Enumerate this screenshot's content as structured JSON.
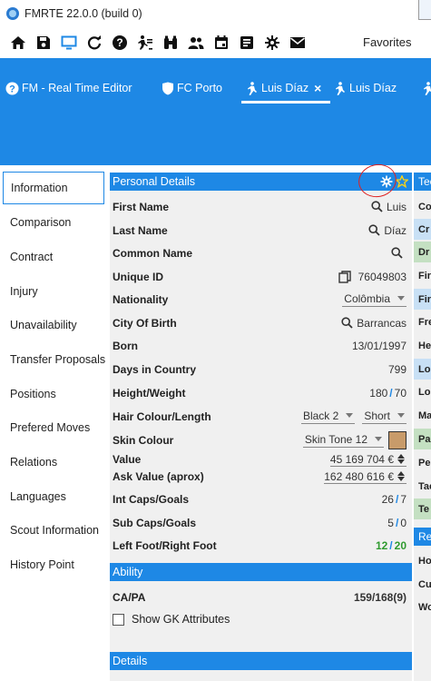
{
  "window": {
    "title": "FMRTE 22.0.0 (build 0)"
  },
  "toolbar": {
    "icons": [
      "home-icon",
      "save-icon",
      "monitor-icon",
      "refresh-icon",
      "help-icon",
      "player-icon",
      "binoculars-icon",
      "people-icon",
      "calendar-icon",
      "notes-icon",
      "gear-icon",
      "mail-icon"
    ],
    "favorites_label": "Favorites"
  },
  "tabs": [
    {
      "label": "FM - Real Time Editor",
      "icon": "help-icon"
    },
    {
      "label": "FC Porto",
      "icon": "shield-icon"
    },
    {
      "label": "Luis Díaz",
      "icon": "player-icon",
      "close": "×"
    },
    {
      "label": "Luis Díaz",
      "icon": "player-icon"
    }
  ],
  "sidebar": {
    "items": [
      {
        "label": "Information"
      },
      {
        "label": "Comparison"
      },
      {
        "label": "Contract"
      },
      {
        "label": "Injury"
      },
      {
        "label": "Unavailability"
      },
      {
        "label": "Transfer Proposals"
      },
      {
        "label": "Positions"
      },
      {
        "label": "Prefered Moves"
      },
      {
        "label": "Relations"
      },
      {
        "label": "Languages"
      },
      {
        "label": "Scout Information"
      },
      {
        "label": "History Point"
      }
    ]
  },
  "personal": {
    "header": "Personal Details",
    "first_name": {
      "label": "First Name",
      "value": "Luis"
    },
    "last_name": {
      "label": "Last Name",
      "value": "Díaz"
    },
    "common_name": {
      "label": "Common Name",
      "value": ""
    },
    "unique_id": {
      "label": "Unique ID",
      "value": "76049803"
    },
    "nationality": {
      "label": "Nationality",
      "value": "Colômbia"
    },
    "city": {
      "label": "City Of Birth",
      "value": "Barrancas"
    },
    "born": {
      "label": "Born",
      "value": "13/01/1997"
    },
    "days": {
      "label": "Days in Country",
      "value": "799"
    },
    "height_weight": {
      "label": "Height/Weight",
      "height": "180",
      "weight": "70"
    },
    "hair": {
      "label": "Hair Colour/Length",
      "colour": "Black 2",
      "length": "Short"
    },
    "skin": {
      "label": "Skin Colour",
      "value": "Skin Tone 12",
      "swatch": "#c89b6a"
    },
    "value": {
      "label": "Value",
      "value": "45 169 704 €"
    },
    "ask_value": {
      "label": "Ask Value (aprox)",
      "value": "162 480 616 €"
    },
    "int_caps": {
      "label": "Int Caps/Goals",
      "caps": "26",
      "goals": "7"
    },
    "sub_caps": {
      "label": "Sub Caps/Goals",
      "caps": "5",
      "goals": "0"
    },
    "foot": {
      "label": "Left Foot/Right Foot",
      "left": "12",
      "right": "20"
    }
  },
  "ability": {
    "header": "Ability",
    "capa_label": "CA/PA",
    "capa_value": "159/168(9)",
    "gk_label": "Show GK Attributes"
  },
  "details": {
    "header": "Details"
  },
  "right_column": {
    "cells": [
      "Tec",
      "Co",
      "Cr",
      "Dr",
      "Fir",
      "Fir",
      "Fre",
      "He",
      "Lo",
      "Lo",
      "Ma",
      "Pa",
      "Pe",
      "Tac",
      "Te",
      "Rep",
      "Ho",
      "Cur",
      "Wo"
    ]
  },
  "colors": {
    "accent": "#1e88e5",
    "annotation": "#e01f1f",
    "green": "#2e9a2e"
  }
}
